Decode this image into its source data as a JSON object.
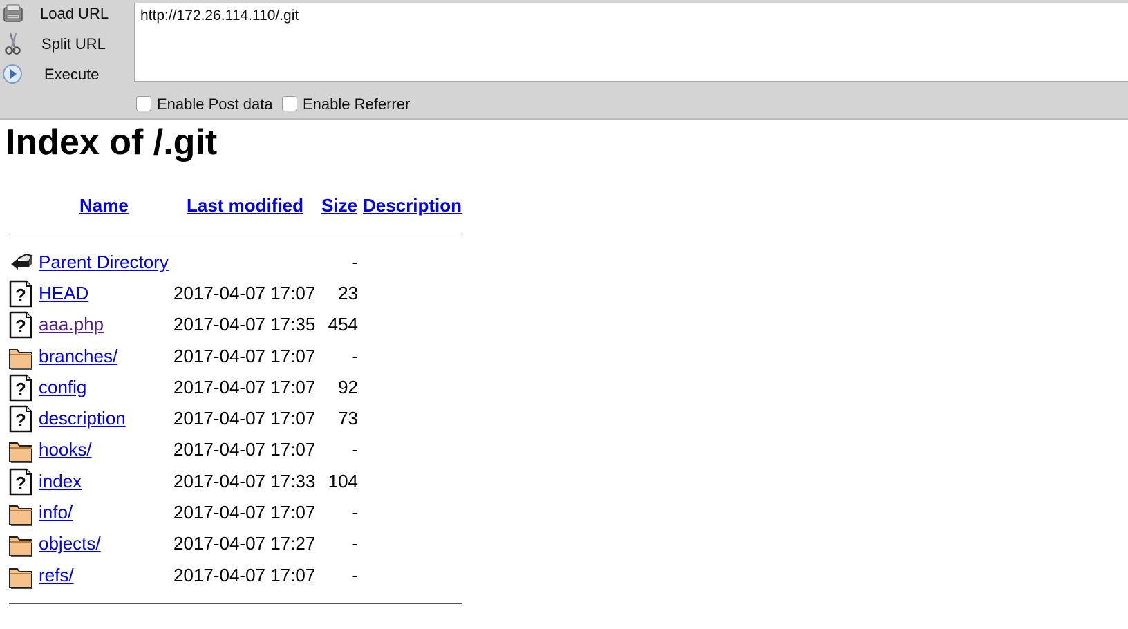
{
  "toolbar": {
    "load_url_label": "Load URL",
    "split_url_label": "Split URL",
    "execute_label": "Execute",
    "url_value": "http://172.26.114.110/.git",
    "enable_post_label": "Enable Post data",
    "enable_referrer_label": "Enable Referrer"
  },
  "page": {
    "title": "Index of /.git",
    "columns": {
      "name": "Name",
      "last_modified": "Last modified",
      "size": "Size",
      "description": "Description"
    },
    "entries": [
      {
        "name": "Parent Directory",
        "modified": "",
        "size": "-",
        "icon": "back-icon"
      },
      {
        "name": "HEAD",
        "modified": "2017-04-07 17:07",
        "size": "23",
        "icon": "unknown-file-icon"
      },
      {
        "name": "aaa.php",
        "modified": "2017-04-07 17:35",
        "size": "454",
        "icon": "unknown-file-icon"
      },
      {
        "name": "branches/",
        "modified": "2017-04-07 17:07",
        "size": "-",
        "icon": "folder-icon"
      },
      {
        "name": "config",
        "modified": "2017-04-07 17:07",
        "size": "92",
        "icon": "unknown-file-icon"
      },
      {
        "name": "description",
        "modified": "2017-04-07 17:07",
        "size": "73",
        "icon": "unknown-file-icon"
      },
      {
        "name": "hooks/",
        "modified": "2017-04-07 17:07",
        "size": "-",
        "icon": "folder-icon"
      },
      {
        "name": "index",
        "modified": "2017-04-07 17:33",
        "size": "104",
        "icon": "unknown-file-icon"
      },
      {
        "name": "info/",
        "modified": "2017-04-07 17:07",
        "size": "-",
        "icon": "folder-icon"
      },
      {
        "name": "objects/",
        "modified": "2017-04-07 17:27",
        "size": "-",
        "icon": "folder-icon"
      },
      {
        "name": "refs/",
        "modified": "2017-04-07 17:07",
        "size": "-",
        "icon": "folder-icon"
      }
    ]
  },
  "colors": {
    "link": "#0000ee",
    "visited_link": "#551a8b",
    "toolbar_bg": "#d4d4d4"
  }
}
